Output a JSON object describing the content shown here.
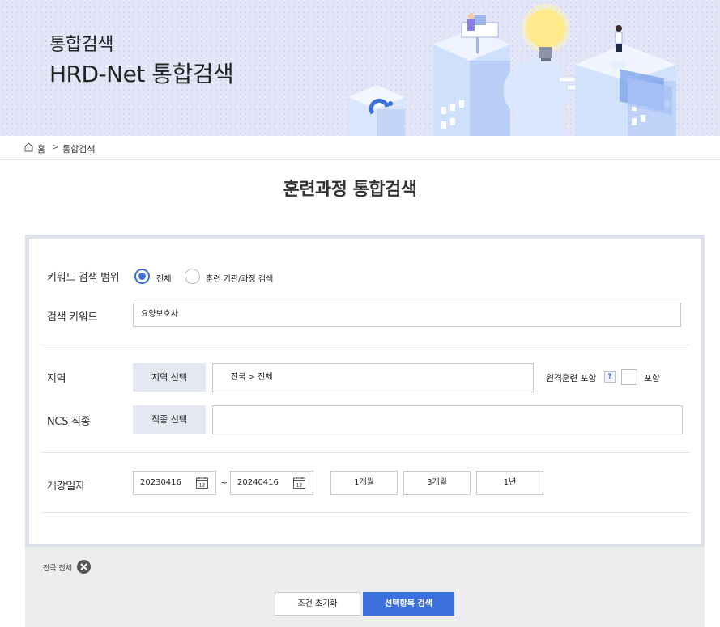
{
  "banner": {
    "title_small": "통합검색",
    "title_large": "HRD-Net 통합검색"
  },
  "breadcrumb": {
    "home": "홈",
    "separator": ">",
    "current": "통합검색"
  },
  "page_title": "훈련과정 통합검색",
  "form": {
    "keyword_scope": {
      "label": "키워드 검색 범위",
      "options": [
        {
          "label": "전체",
          "checked": true
        },
        {
          "label": "훈련 기관/과정 검색",
          "checked": false
        }
      ]
    },
    "keyword": {
      "label": "검색 키워드",
      "value": "요양보호사"
    },
    "region": {
      "label": "지역",
      "button": "지역 선택",
      "value": "전국 > 전체",
      "remote_label": "원격훈련 포함",
      "help": "?",
      "include_label": "포함",
      "include_checked": false
    },
    "ncs": {
      "label": "NCS 직종",
      "button": "직종 선택",
      "value": ""
    },
    "date": {
      "label": "개강일자",
      "start": "20230416",
      "end": "20240416",
      "tilde": "~",
      "calendar_day": "12",
      "periods": [
        "1개월",
        "3개월",
        "1년"
      ]
    }
  },
  "selected_tags": [
    {
      "label": "전국 전체"
    }
  ],
  "actions": {
    "reset": "조건 초기화",
    "search": "선택항목 검색"
  },
  "colors": {
    "accent": "#3b6fd9",
    "banner_bg": "#e3e6f6",
    "button_bg": "#e3e8f3"
  }
}
